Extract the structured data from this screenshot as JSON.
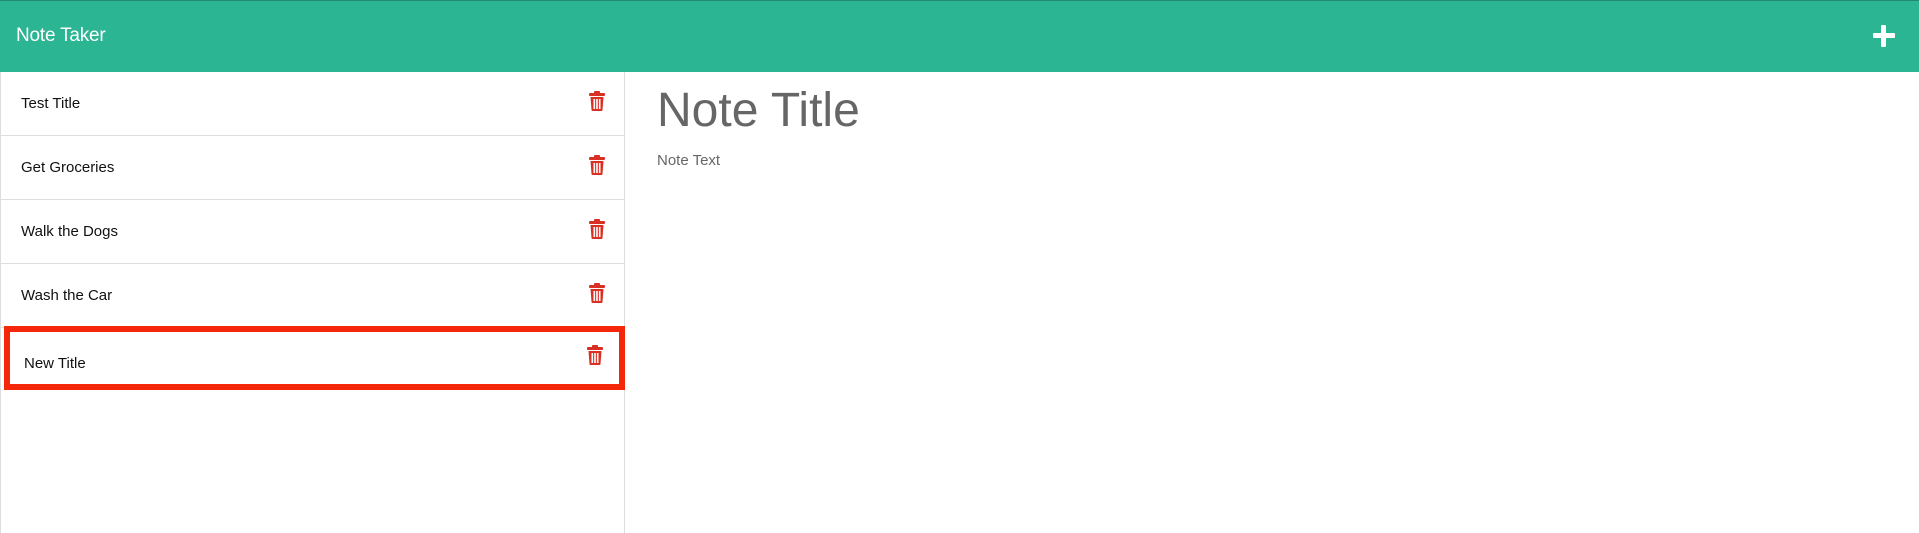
{
  "navbar": {
    "brand": "Note Taker",
    "add_icon": "plus-icon",
    "background_color": "#2bb593"
  },
  "sidebar": {
    "delete_icon": "trash-icon",
    "delete_icon_color": "#d93025",
    "notes": [
      {
        "title": "Test Title"
      },
      {
        "title": "Get Groceries"
      },
      {
        "title": "Walk the Dogs"
      },
      {
        "title": "Wash the Car"
      },
      {
        "title": "New Title",
        "highlighted": true
      }
    ],
    "highlight_color": "#f5270b"
  },
  "editor": {
    "title_placeholder": "Note Title",
    "title_value": "",
    "text_placeholder": "Note Text",
    "text_value": ""
  }
}
